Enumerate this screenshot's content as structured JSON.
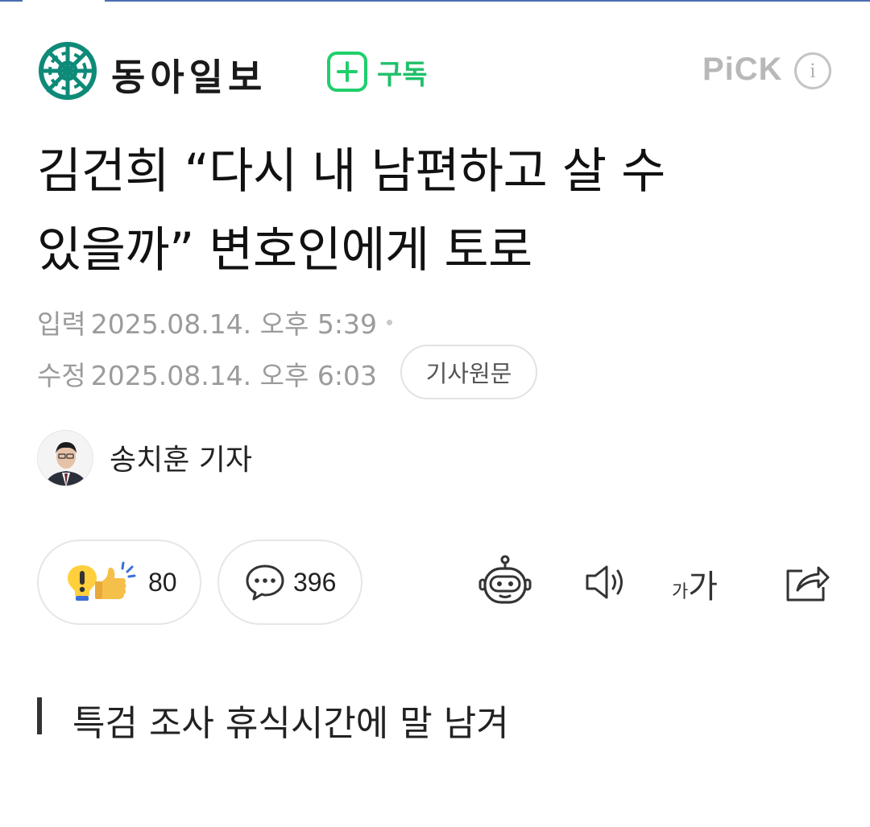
{
  "header": {
    "press_name": "동아일보",
    "subscribe_label": "구독",
    "pick_label": "PiCK",
    "info_label": "i"
  },
  "article": {
    "headline_line1": "김건희 “다시 내 남편하고 살 수",
    "headline_line2": "있을까” 변호인에게 토로",
    "input_label": "입력",
    "input_date": "2025.08.14. 오후 5:39",
    "edit_label": "수정",
    "edit_date": "2025.08.14. 오후 6:03",
    "original_button": "기사원문",
    "reporter": "송치훈 기자",
    "subtitle": "특검 조사 휴식시간에 말 남겨"
  },
  "toolbar": {
    "reaction_count": "80",
    "comment_count": "396",
    "font_small": "가",
    "font_big": "가"
  },
  "colors": {
    "accent_green": "#1fcf6b",
    "logo_teal": "#0e8a78",
    "muted_text": "#9b9b9b"
  },
  "icons": [
    "press-logo-icon",
    "plus-icon",
    "info-icon",
    "reaction-emoji-icon",
    "comment-bubble-icon",
    "summary-bot-icon",
    "speaker-icon",
    "font-size-icon",
    "share-icon"
  ]
}
